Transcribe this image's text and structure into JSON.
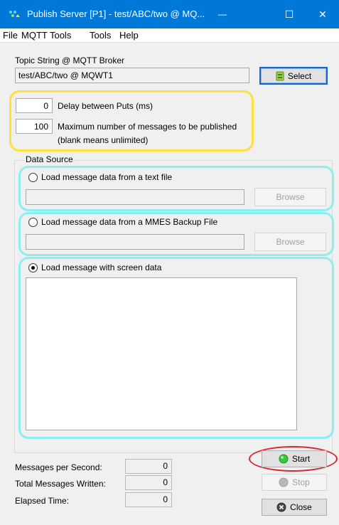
{
  "window": {
    "title": "Publish Server [P1] - test/ABC/two @ MQ...",
    "minimize": "—",
    "maximize": "☐",
    "close": "✕"
  },
  "menu": [
    "File",
    "MQTT Tools",
    "Tools",
    "Help"
  ],
  "topic": {
    "label": "Topic String @ MQTT Broker",
    "value": "test/ABC/two @ MQWT1",
    "select_label": "Select"
  },
  "settings": {
    "delay_value": "0",
    "delay_label": "Delay between Puts (ms)",
    "max_value": "100",
    "max_label_line1": "Maximum number of messages to be published",
    "max_label_line2": "(blank means unlimited)"
  },
  "data_source": {
    "legend": "Data Source",
    "text_file_label": "Load message data from a text file",
    "text_file_path": "",
    "browse_label": "Browse",
    "backup_label": "Load message data from a MMES Backup File",
    "backup_path": "",
    "browse2_label": "Browse",
    "screen_label": "Load message with screen data",
    "screen_text": "",
    "selected": "screen"
  },
  "stats": {
    "mps_label": "Messages per Second:",
    "mps_value": "0",
    "total_label": "Total Messages Written:",
    "total_value": "0",
    "elapsed_label": "Elapsed Time:",
    "elapsed_value": "0"
  },
  "buttons": {
    "start": "Start",
    "stop": "Stop",
    "close": "Close"
  },
  "colors": {
    "titlebar": "#0078d7",
    "highlight_yellow": "#ffe13a",
    "highlight_cyan": "#8deef0",
    "highlight_red": "#d7262e",
    "start_icon": "#3cc43c"
  },
  "icons": {
    "app": "publish-server-icon",
    "select": "select-icon",
    "start": "green-circle-icon",
    "stop": "gray-circle-icon",
    "close": "close-circle-icon"
  }
}
